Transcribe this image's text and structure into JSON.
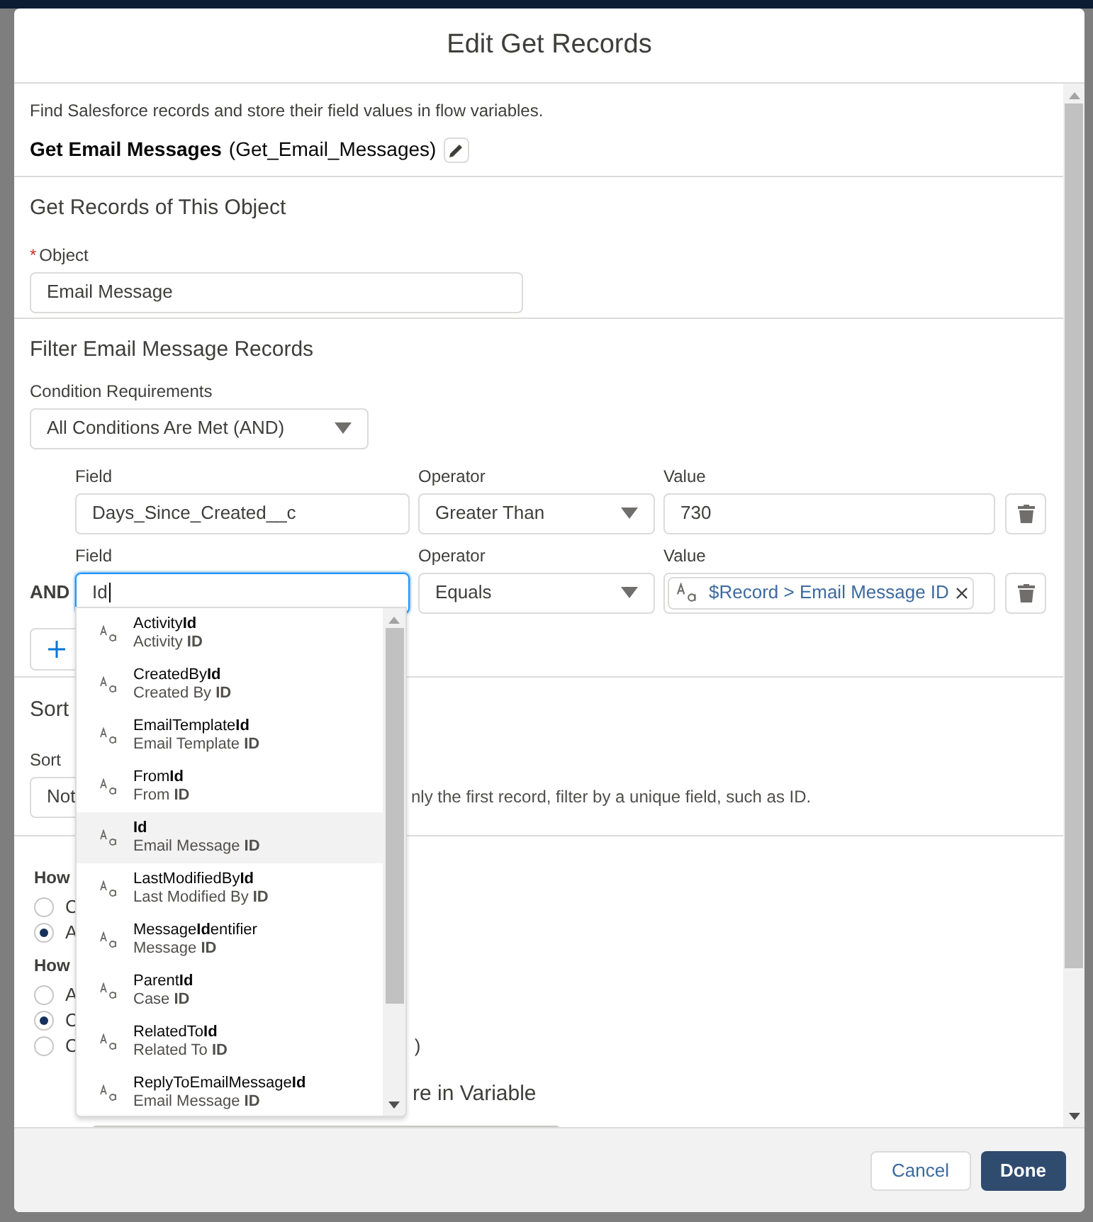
{
  "modal": {
    "title": "Edit Get Records"
  },
  "description": "Find Salesforce records and store their field values in flow variables.",
  "element": {
    "label": "Get Email Messages",
    "api_name": "(Get_Email_Messages)"
  },
  "object_section": {
    "heading": "Get Records of This Object",
    "field_label": "Object",
    "required_mark": "*",
    "value": "Email Message"
  },
  "filter_section": {
    "heading": "Filter Email Message Records",
    "requirements_label": "Condition Requirements",
    "requirements_value": "All Conditions Are Met (AND)",
    "conditions": [
      {
        "field_label": "Field",
        "field": "Days_Since_Created__c",
        "focused": false,
        "operator_label": "Operator",
        "operator": "Greater Than",
        "value_label": "Value",
        "kind": "text",
        "value": "730"
      },
      {
        "prefix": "AND",
        "field_label": "Field",
        "field": "Id",
        "focused": true,
        "operator_label": "Operator",
        "operator": "Equals",
        "value_label": "Value",
        "kind": "pill",
        "value": "$Record > Email Message ID"
      }
    ]
  },
  "sort_section": {
    "heading": "Sort",
    "label": "Sort",
    "select_value": "Not",
    "hint": "nly the first record, filter by a unique field, such as ID."
  },
  "store_section": {
    "question_1": "How",
    "options_1": [
      {
        "label": "C",
        "selected": false
      },
      {
        "label": "A",
        "selected": true
      }
    ],
    "question_2": "How",
    "options_2": [
      {
        "label": "A",
        "selected": false
      },
      {
        "label": "C",
        "selected": true
      },
      {
        "label": "C",
        "tail": ")",
        "selected": false
      }
    ],
    "store_heading": "re in Variable"
  },
  "dropdown": {
    "items": [
      {
        "label": "Activity**Id**",
        "sublabel": "Activity **ID**",
        "selected": false
      },
      {
        "label": "CreatedBy**Id**",
        "sublabel": "Created By **ID**",
        "selected": false
      },
      {
        "label": "EmailTemplate**Id**",
        "sublabel": "Email Template **ID**",
        "selected": false
      },
      {
        "label": "From**Id**",
        "sublabel": "From **ID**",
        "selected": false
      },
      {
        "label": "**Id**",
        "sublabel": "Email Message **ID**",
        "selected": true
      },
      {
        "label": "LastModifiedBy**Id**",
        "sublabel": "Last Modified By **ID**",
        "selected": false
      },
      {
        "label": "Message**Id**entifier",
        "sublabel": "Message **ID**",
        "selected": false
      },
      {
        "label": "Parent**Id**",
        "sublabel": "Case **ID**",
        "selected": false
      },
      {
        "label": "RelatedTo**Id**",
        "sublabel": "Related To **ID**",
        "selected": false
      },
      {
        "label": "ReplyToEmailMessage**Id**",
        "sublabel": "Email Message **ID**",
        "selected": false
      }
    ]
  },
  "footer": {
    "cancel": "Cancel",
    "done": "Done"
  }
}
